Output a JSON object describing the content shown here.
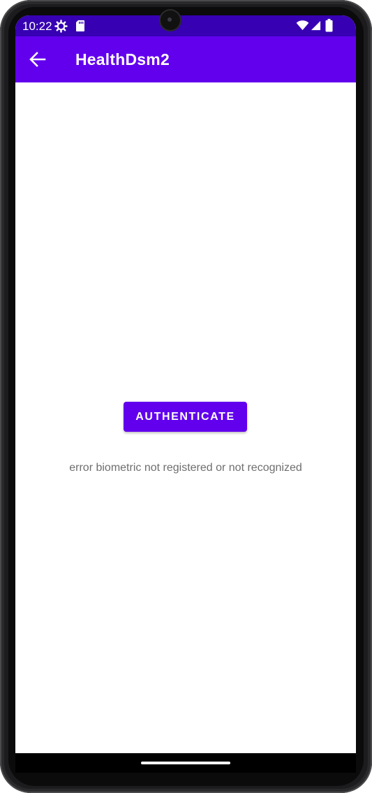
{
  "status_bar": {
    "time": "10:22",
    "icons": [
      "settings-gear-icon",
      "sd-card-icon",
      "wifi-icon",
      "signal-icon",
      "battery-icon"
    ],
    "background": "#3700b3"
  },
  "app_bar": {
    "title": "HealthDsm2",
    "back_icon": "arrow-back-icon",
    "background": "#6200ee"
  },
  "main": {
    "authenticate_label": "AUTHENTICATE",
    "error_message": "error biometric not registered or not recognized",
    "accent": "#6200ee"
  }
}
